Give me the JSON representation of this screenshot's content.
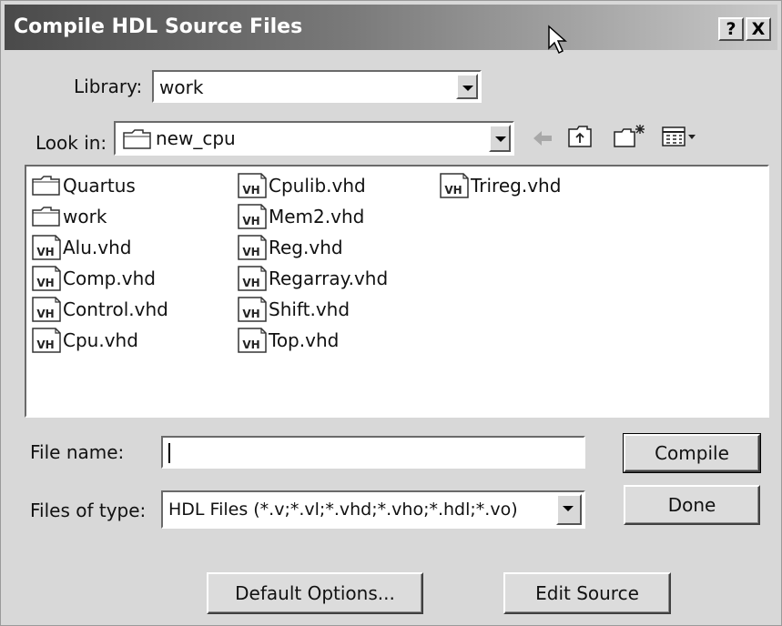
{
  "window": {
    "title": "Compile HDL Source Files",
    "help_label": "?",
    "close_label": "X"
  },
  "library": {
    "label": "Library:",
    "value": "work"
  },
  "look_in": {
    "label": "Look in:",
    "value": "new_cpu"
  },
  "files": [
    {
      "name": "Quartus",
      "type": "folder"
    },
    {
      "name": "work",
      "type": "folder"
    },
    {
      "name": "Alu.vhd",
      "type": "vhd"
    },
    {
      "name": "Comp.vhd",
      "type": "vhd"
    },
    {
      "name": "Control.vhd",
      "type": "vhd"
    },
    {
      "name": "Cpu.vhd",
      "type": "vhd"
    },
    {
      "name": "Cpulib.vhd",
      "type": "vhd"
    },
    {
      "name": "Mem2.vhd",
      "type": "vhd"
    },
    {
      "name": "Reg.vhd",
      "type": "vhd"
    },
    {
      "name": "Regarray.vhd",
      "type": "vhd"
    },
    {
      "name": "Shift.vhd",
      "type": "vhd"
    },
    {
      "name": "Top.vhd",
      "type": "vhd"
    },
    {
      "name": "Trireg.vhd",
      "type": "vhd"
    }
  ],
  "vhd_icon_text": "VH",
  "file_name": {
    "label": "File name:",
    "value": ""
  },
  "file_type": {
    "label": "Files of type:",
    "value": "HDL Files (*.v;*.vl;*.vhd;*.vho;*.hdl;*.vo)"
  },
  "buttons": {
    "compile": "Compile",
    "done": "Done",
    "default_options": "Default Options...",
    "edit_source": "Edit Source"
  },
  "icons": {
    "back": "back-arrow-icon",
    "up": "up-folder-icon",
    "new_folder": "new-folder-icon",
    "view_menu": "view-menu-icon"
  }
}
